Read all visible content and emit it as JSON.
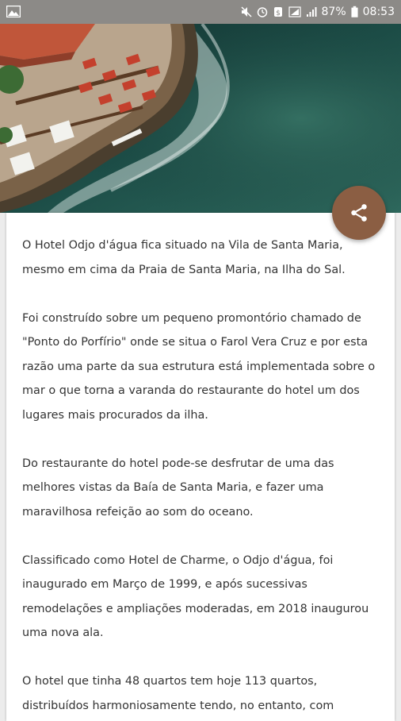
{
  "status_bar": {
    "battery": "87%",
    "time": "08:53",
    "icons": [
      "image-icon",
      "mute-icon",
      "alarm-icon",
      "data-saver-icon",
      "wifi-icon",
      "signal-icon",
      "battery-icon"
    ]
  },
  "hero": {
    "icon": "aerial-photo-of-hotel-terrace-by-the-sea"
  },
  "fab": {
    "icon": "share-icon",
    "color": "#8b5e43"
  },
  "article": {
    "paragraphs": [
      "O Hotel Odjo d'água fica situado na Vila de Santa Maria, mesmo em cima da Praia de Santa Maria, na Ilha do Sal.",
      "Foi construído sobre um pequeno promontório chamado de \"Ponto do Porfírio\" onde se situa o Farol Vera Cruz e por esta razão uma parte da sua estrutura está implementada sobre o mar o que torna a varanda do restaurante do hotel um dos lugares mais procurados da ilha.",
      "Do restaurante do hotel pode-se desfrutar de uma das melhores vistas da Baía de Santa Maria, e fazer uma maravilhosa refeição ao som do oceano.",
      "Classificado como Hotel de Charme, o Odjo d'água, foi inaugurado em Março de 1999, e após sucessivas remodelações e ampliações moderadas, em 2018 inaugurou uma nova ala.",
      "O hotel que tinha 48 quartos tem hoje 113 quartos, distribuídos harmoniosamente tendo, no entanto, com"
    ]
  }
}
